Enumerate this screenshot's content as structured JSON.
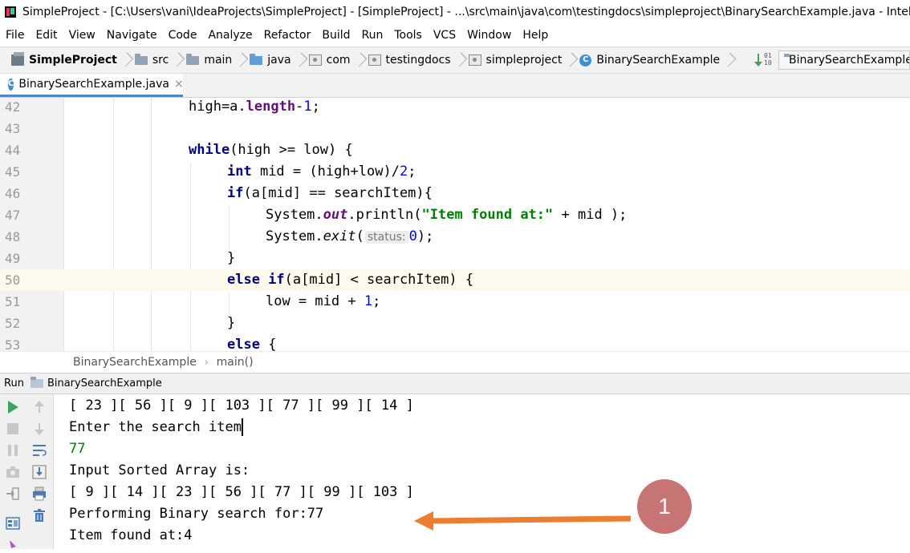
{
  "window": {
    "title": "SimpleProject - [C:\\Users\\vani\\IdeaProjects\\SimpleProject] - [SimpleProject] - ...\\src\\main\\java\\com\\testingdocs\\simpleproject\\BinarySearchExample.java - IntelliJ IDEA"
  },
  "menu": [
    "File",
    "Edit",
    "View",
    "Navigate",
    "Code",
    "Analyze",
    "Refactor",
    "Build",
    "Run",
    "Tools",
    "VCS",
    "Window",
    "Help"
  ],
  "navbar": {
    "crumbs": [
      "SimpleProject",
      "src",
      "main",
      "java",
      "com",
      "testingdocs",
      "simpleproject",
      "BinarySearchExample"
    ],
    "run_config": "BinarySearchExample"
  },
  "editor_tab": {
    "label": "BinarySearchExample.java",
    "close": "×"
  },
  "code_lines": [
    {
      "num": "42",
      "text": "high=a.length-1;"
    },
    {
      "num": "43",
      "text": ""
    },
    {
      "num": "44",
      "text": "while(high >= low) {"
    },
    {
      "num": "45",
      "text": "int mid = (high+low)/2;"
    },
    {
      "num": "46",
      "text": "if(a[mid] == searchItem){"
    },
    {
      "num": "47",
      "text": "System.out.println(\"Item found at:\" + mid );"
    },
    {
      "num": "48",
      "text": "System.exit( status: 0);"
    },
    {
      "num": "49",
      "text": "}"
    },
    {
      "num": "50",
      "text": "else if(a[mid] < searchItem) {"
    },
    {
      "num": "51",
      "text": "low = mid + 1;"
    },
    {
      "num": "52",
      "text": "}"
    },
    {
      "num": "53",
      "text": "else {"
    }
  ],
  "code_parts": {
    "l42_a": "high=a.",
    "l42_b": "length",
    "l42_c": "-",
    "l42_d": "1",
    "l42_e": ";",
    "l44_a": "while",
    "l44_b": "(high >= low) {",
    "l45_a": "int",
    "l45_b": " mid = (high+low)/",
    "l45_c": "2",
    "l45_d": ";",
    "l46_a": "if",
    "l46_b": "(a[mid] == searchItem){",
    "l47_a": "System.",
    "l47_b": "out",
    "l47_c": ".println(",
    "l47_d": "\"Item found at:\"",
    "l47_e": " + mid );",
    "l48_a": "System.",
    "l48_b": "exit",
    "l48_c": "(",
    "l48_hint": "status:",
    "l48_d": "0",
    "l48_e": ");",
    "l49": "}",
    "l50_a": "else if",
    "l50_b": "(a[mid] < searchItem) {",
    "l51_a": "low = mid + ",
    "l51_b": "1",
    "l51_c": ";",
    "l52": "}",
    "l53_a": "else",
    "l53_b": " {"
  },
  "breadcrumb": {
    "class": "BinarySearchExample",
    "method": "main()"
  },
  "run_panel": {
    "label": "Run",
    "config": "BinarySearchExample"
  },
  "console": [
    {
      "text": "[ 23 ][ 56 ][ 9 ][ 103 ][ 77 ][ 99 ][ 14 ]",
      "kind": "output"
    },
    {
      "text": "Enter the search item",
      "kind": "output"
    },
    {
      "text": "77",
      "kind": "input"
    },
    {
      "text": "Input Sorted Array is:",
      "kind": "output"
    },
    {
      "text": "[ 9 ][ 14 ][ 23 ][ 56 ][ 77 ][ 99 ][ 103 ]",
      "kind": "output"
    },
    {
      "text": "Performing Binary search for:77",
      "kind": "output"
    },
    {
      "text": "Item found at:4",
      "kind": "output"
    }
  ],
  "annotation": {
    "badge": "1",
    "color": "#ed7d31"
  },
  "colors": {
    "keyword": "#000080",
    "field": "#660e7a",
    "number": "#0000ff",
    "string": "#008000",
    "input": "#007b00"
  }
}
